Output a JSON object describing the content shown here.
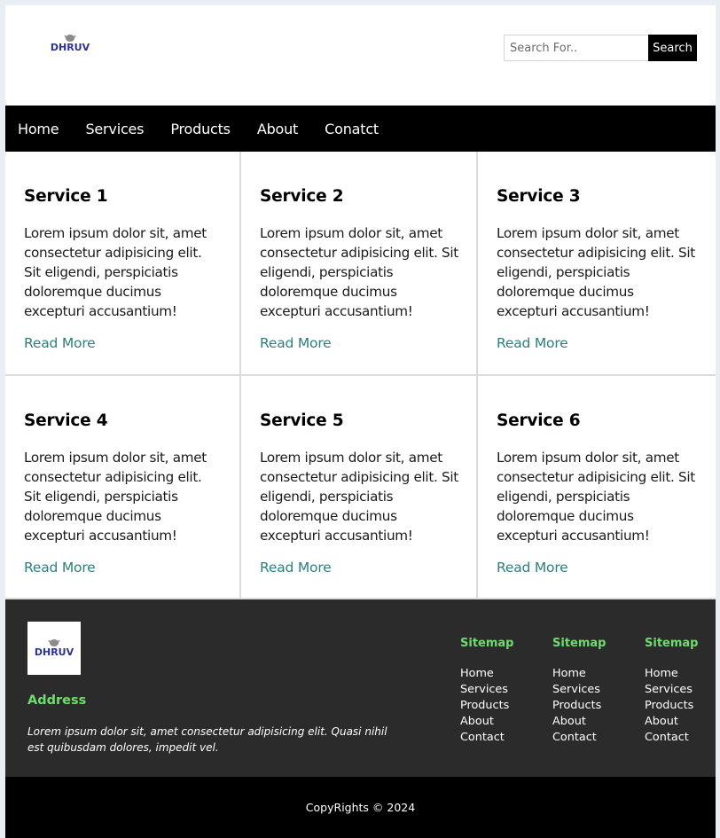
{
  "header": {
    "logo_text": "DHRUV",
    "search": {
      "placeholder": "Search For..",
      "button_label": "Search"
    }
  },
  "nav": {
    "items": [
      "Home",
      "Services",
      "Products",
      "About",
      "Conatct"
    ]
  },
  "services": [
    {
      "title": "Service 1",
      "text": "Lorem ipsum dolor sit, amet consectetur adipisicing elit. Sit eligendi, perspiciatis doloremque ducimus excepturi accusantium!",
      "link": "Read More"
    },
    {
      "title": "Service 2",
      "text": "Lorem ipsum dolor sit, amet consectetur adipisicing elit. Sit eligendi, perspiciatis doloremque ducimus excepturi accusantium!",
      "link": "Read More"
    },
    {
      "title": "Service 3",
      "text": "Lorem ipsum dolor sit, amet consectetur adipisicing elit. Sit eligendi, perspiciatis doloremque ducimus excepturi accusantium!",
      "link": "Read More"
    },
    {
      "title": "Service 4",
      "text": "Lorem ipsum dolor sit, amet consectetur adipisicing elit. Sit eligendi, perspiciatis doloremque ducimus excepturi accusantium!",
      "link": "Read More"
    },
    {
      "title": "Service 5",
      "text": "Lorem ipsum dolor sit, amet consectetur adipisicing elit. Sit eligendi, perspiciatis doloremque ducimus excepturi accusantium!",
      "link": "Read More"
    },
    {
      "title": "Service 6",
      "text": "Lorem ipsum dolor sit, amet consectetur adipisicing elit. Sit eligendi, perspiciatis doloremque ducimus excepturi accusantium!",
      "link": "Read More"
    }
  ],
  "footer": {
    "address_title": "Address",
    "address_text": "Lorem ipsum dolor sit, amet consectetur adipisicing elit. Quasi nihil est quibusdam dolores, impedit vel.",
    "sitemaps": [
      {
        "title": "Sitemap",
        "links": [
          "Home",
          "Services",
          "Products",
          "About",
          "Contact"
        ]
      },
      {
        "title": "Sitemap",
        "links": [
          "Home",
          "Services",
          "Products",
          "About",
          "Contact"
        ]
      },
      {
        "title": "Sitemap",
        "links": [
          "Home",
          "Services",
          "Products",
          "About",
          "Contact"
        ]
      }
    ],
    "copyright": "CopyRights © 2024"
  },
  "colors": {
    "accent_green": "#6fdc6f",
    "link_teal": "#2d7f7f",
    "footer_bg": "#2b2b2b",
    "nav_bg": "#000000",
    "logo_blue": "#2e3192"
  }
}
